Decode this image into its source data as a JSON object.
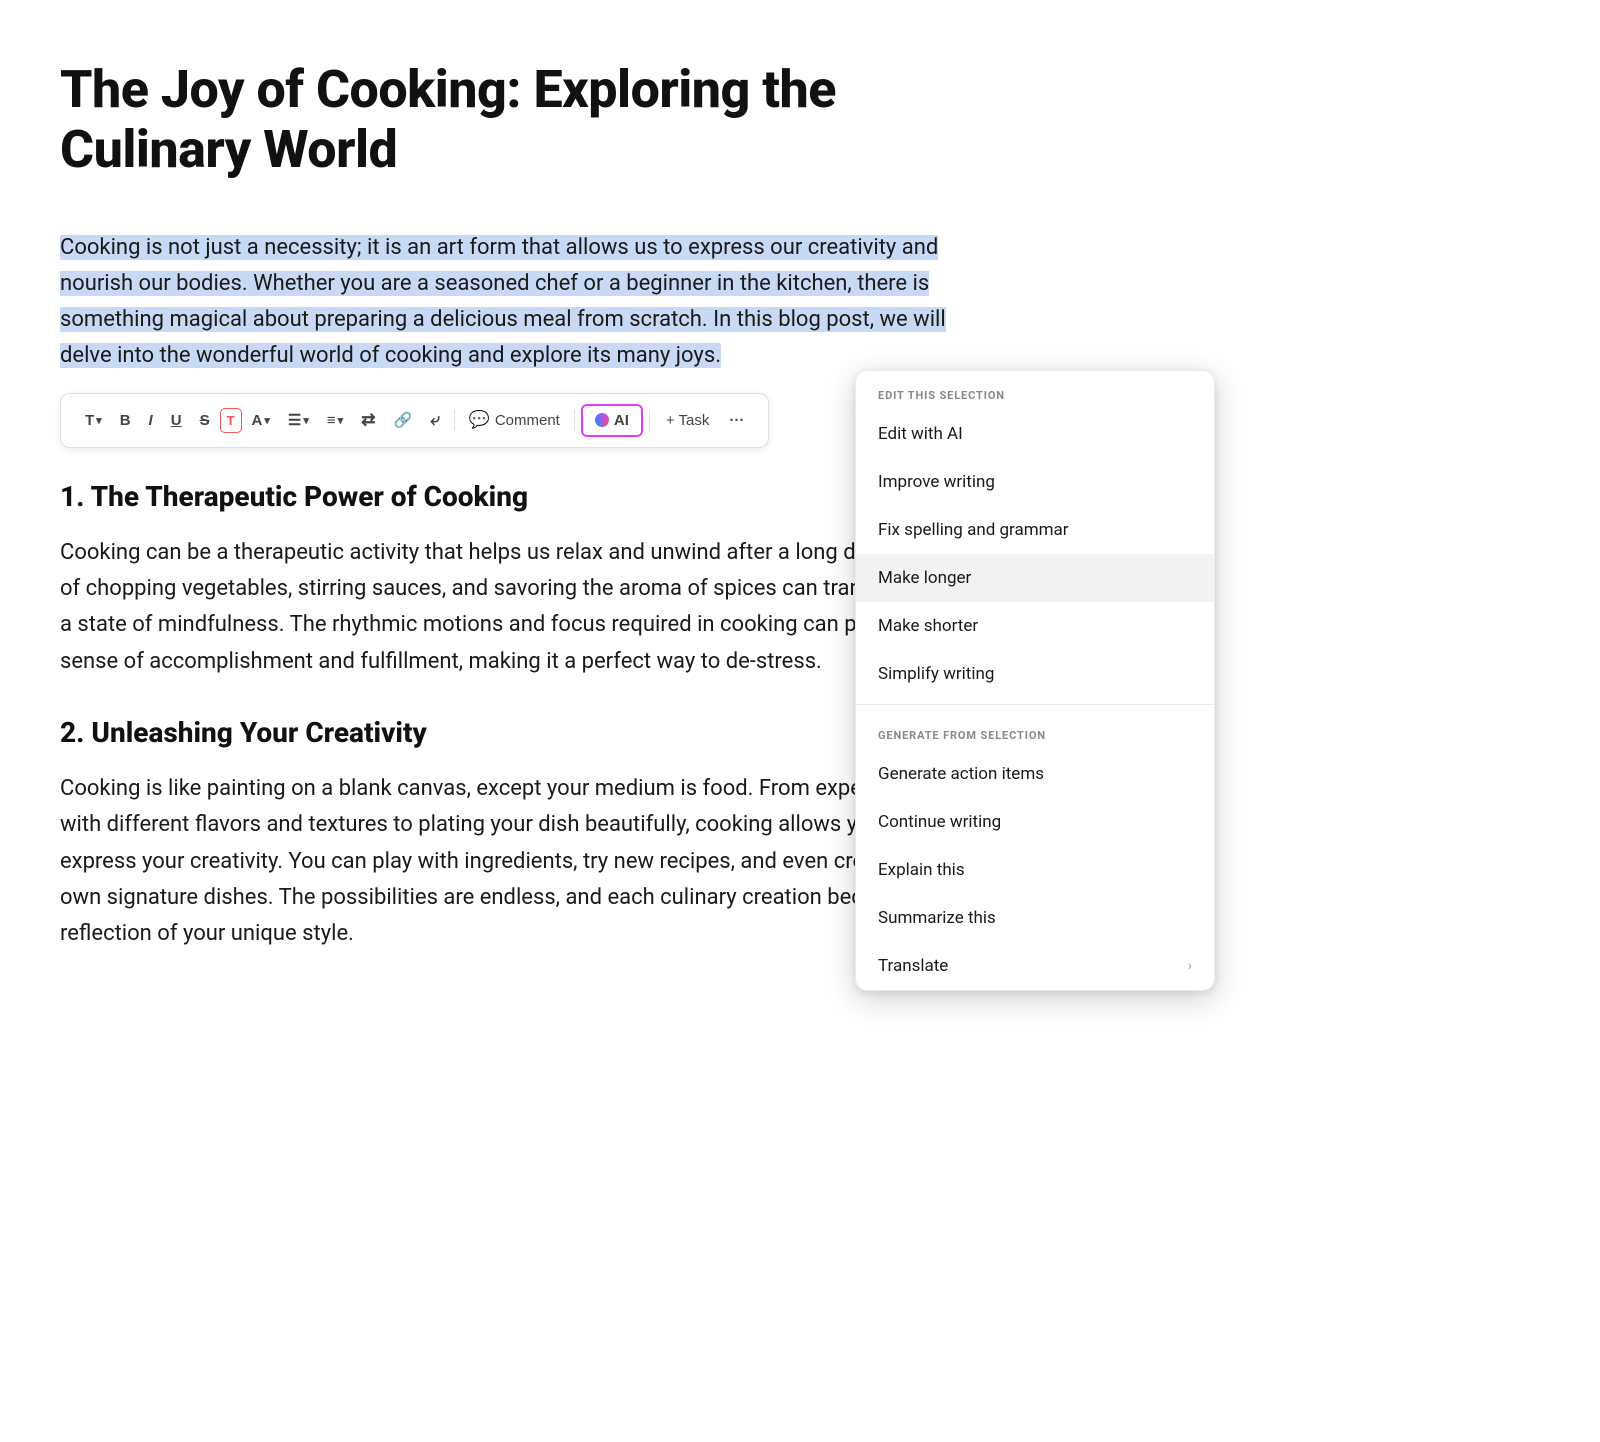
{
  "document": {
    "title": "The Joy of Cooking: Exploring the Culinary World",
    "selected_paragraph": "Cooking is not just a necessity; it is an art form that allows us to express our creativity and nourish our bodies. Whether you are a seasoned chef or a beginner in the kitchen, there is something magical about preparing a delicious meal from scratch. In this blog post, we will delve into the wonderful world of cooking and explore its many joys.",
    "section1": {
      "heading": "1. The Therapeutic Power of Cooking",
      "body": "Cooking can be a therapeutic activity that helps us relax and unwind after a long day. The act of chopping vegetables, stirring sauces, and savoring the aroma of spices can transport us to a state of mindfulness. The rhythmic motions and focus required in cooking can provide a sense of accomplishment and fulfillment, making it a perfect way to de-stress."
    },
    "section2": {
      "heading": "2. Unleashing Your Creativity",
      "body": "Cooking is like painting on a blank canvas, except your medium is food. From experimenting with different flavors and textures to plating your dish beautifully, cooking allows you to express your creativity. You can play with ingredients, try new recipes, and even create your own signature dishes. The possibilities are endless, and each culinary creation becomes a reflection of your unique style."
    }
  },
  "toolbar": {
    "text_label": "T",
    "bold_label": "B",
    "italic_label": "I",
    "underline_label": "U",
    "strikethrough_label": "S",
    "highlight_label": "T",
    "font_color_label": "A",
    "align_label": "≡",
    "bullet_label": "≡",
    "indent_label": "≡",
    "link_label": "🔗",
    "comment_label": "Comment",
    "ai_label": "AI",
    "task_label": "+ Task",
    "more_label": "···"
  },
  "dropdown": {
    "edit_section_label": "EDIT THIS SELECTION",
    "generate_section_label": "GENERATE FROM SELECTION",
    "items_edit": [
      {
        "label": "Edit with AI",
        "has_chevron": false
      },
      {
        "label": "Improve writing",
        "has_chevron": false
      },
      {
        "label": "Fix spelling and grammar",
        "has_chevron": false
      },
      {
        "label": "Make longer",
        "has_chevron": false,
        "hovered": true
      },
      {
        "label": "Make shorter",
        "has_chevron": false
      },
      {
        "label": "Simplify writing",
        "has_chevron": false
      }
    ],
    "items_generate": [
      {
        "label": "Generate action items",
        "has_chevron": false
      },
      {
        "label": "Continue writing",
        "has_chevron": false
      },
      {
        "label": "Explain this",
        "has_chevron": false
      },
      {
        "label": "Summarize this",
        "has_chevron": false
      },
      {
        "label": "Translate",
        "has_chevron": true
      }
    ]
  }
}
